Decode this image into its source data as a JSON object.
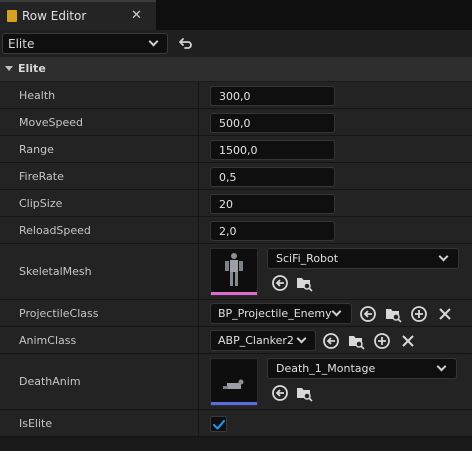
{
  "tab": {
    "title": "Row Editor",
    "close_glyph": "✕",
    "icon": "row-editor-icon"
  },
  "toolbar": {
    "row_name": "Elite",
    "undo_icon": "undo-arrow-icon"
  },
  "category": {
    "label": "Elite"
  },
  "properties": {
    "health": {
      "label": "Health",
      "value": "300,0"
    },
    "move_speed": {
      "label": "MoveSpeed",
      "value": "500,0"
    },
    "range": {
      "label": "Range",
      "value": "1500,0"
    },
    "fire_rate": {
      "label": "FireRate",
      "value": "0,5"
    },
    "clip_size": {
      "label": "ClipSize",
      "value": "20"
    },
    "reload_speed": {
      "label": "ReloadSpeed",
      "value": "2,0"
    },
    "skeletal_mesh": {
      "label": "SkeletalMesh",
      "value": "SciFi_Robot",
      "thumb_color": "#e06ad0"
    },
    "projectile_class": {
      "label": "ProjectileClass",
      "value": "BP_Projectile_Enemy"
    },
    "anim_class": {
      "label": "AnimClass",
      "value": "ABP_Clanker2"
    },
    "death_anim": {
      "label": "DeathAnim",
      "value": "Death_1_Montage",
      "thumb_color": "#5b6be0"
    },
    "is_elite": {
      "label": "IsElite",
      "checked": true
    }
  },
  "colors": {
    "accent": "#1f8fe8",
    "background": "#232323"
  }
}
